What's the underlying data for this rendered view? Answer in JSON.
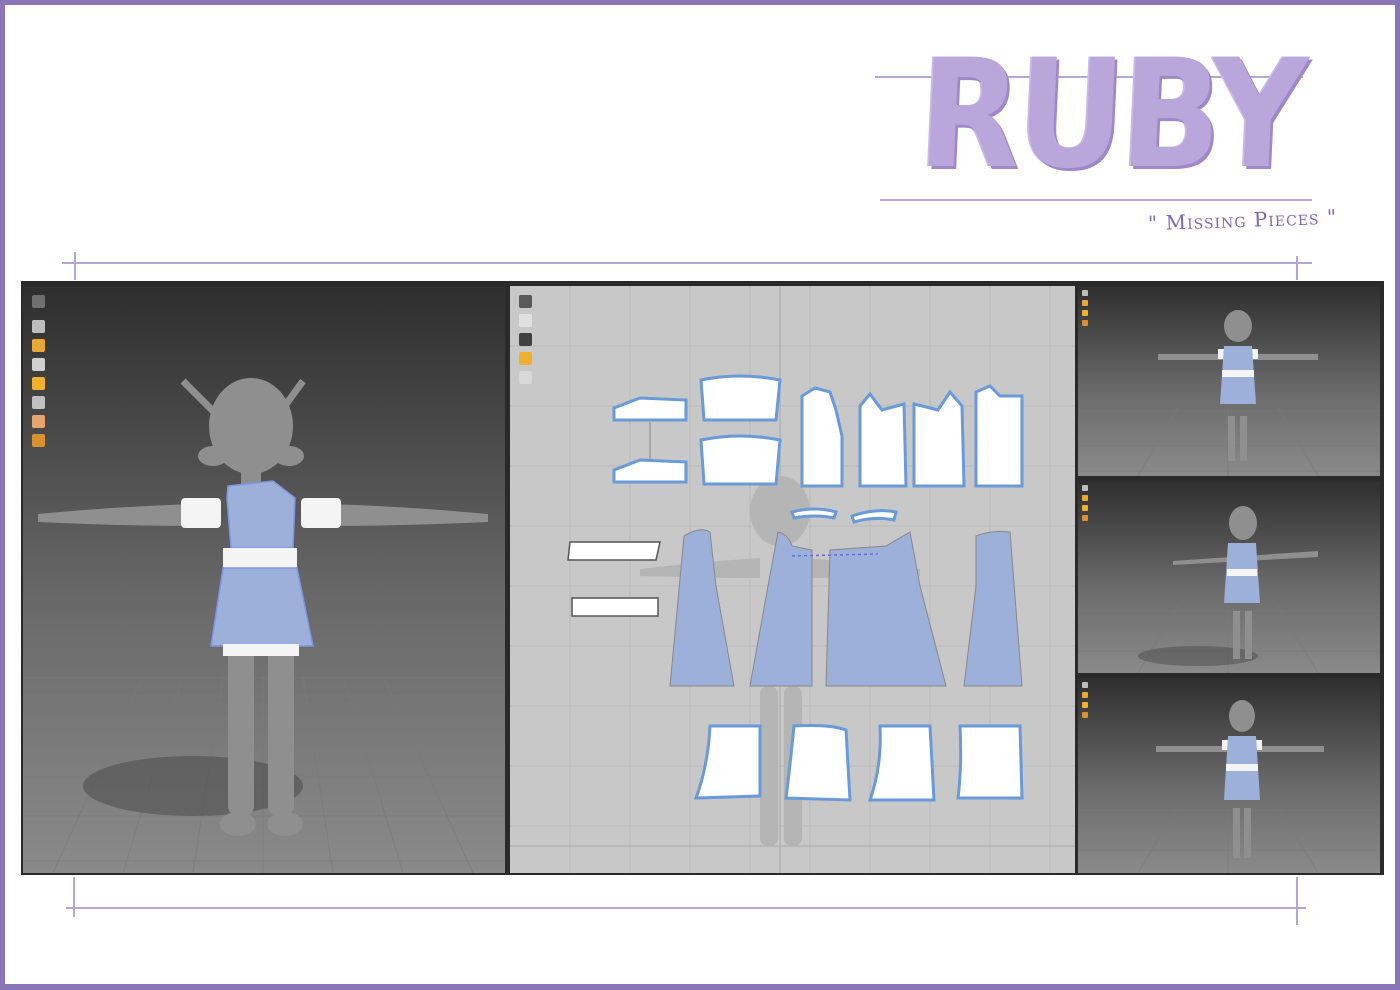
{
  "header": {
    "title": "RUBY",
    "subtitle": "\" Missing Pieces \""
  },
  "colors": {
    "border": "#8a76b6",
    "title": "#b9a7db",
    "subtitle": "#7c68b4",
    "garment_blue": "#9cb0d9",
    "pattern_outline": "#6a9ad8",
    "viewport_dark": "#3a3a3a",
    "pattern_bg": "#c8c8c8"
  },
  "viewports": {
    "main_3d": {
      "toolbar_icons": [
        "avatar-icon",
        "garment-icon",
        "transform-icon",
        "pin-icon",
        "fold-icon",
        "measure-icon",
        "skin-icon",
        "texture-icon"
      ]
    },
    "pattern_2d": {
      "toolbar_icons": [
        "pen-icon",
        "select-icon",
        "sewing-icon",
        "fold-icon",
        "lock-icon"
      ]
    },
    "thumbs": [
      {
        "view": "front"
      },
      {
        "view": "three-quarter"
      },
      {
        "view": "back"
      }
    ]
  }
}
